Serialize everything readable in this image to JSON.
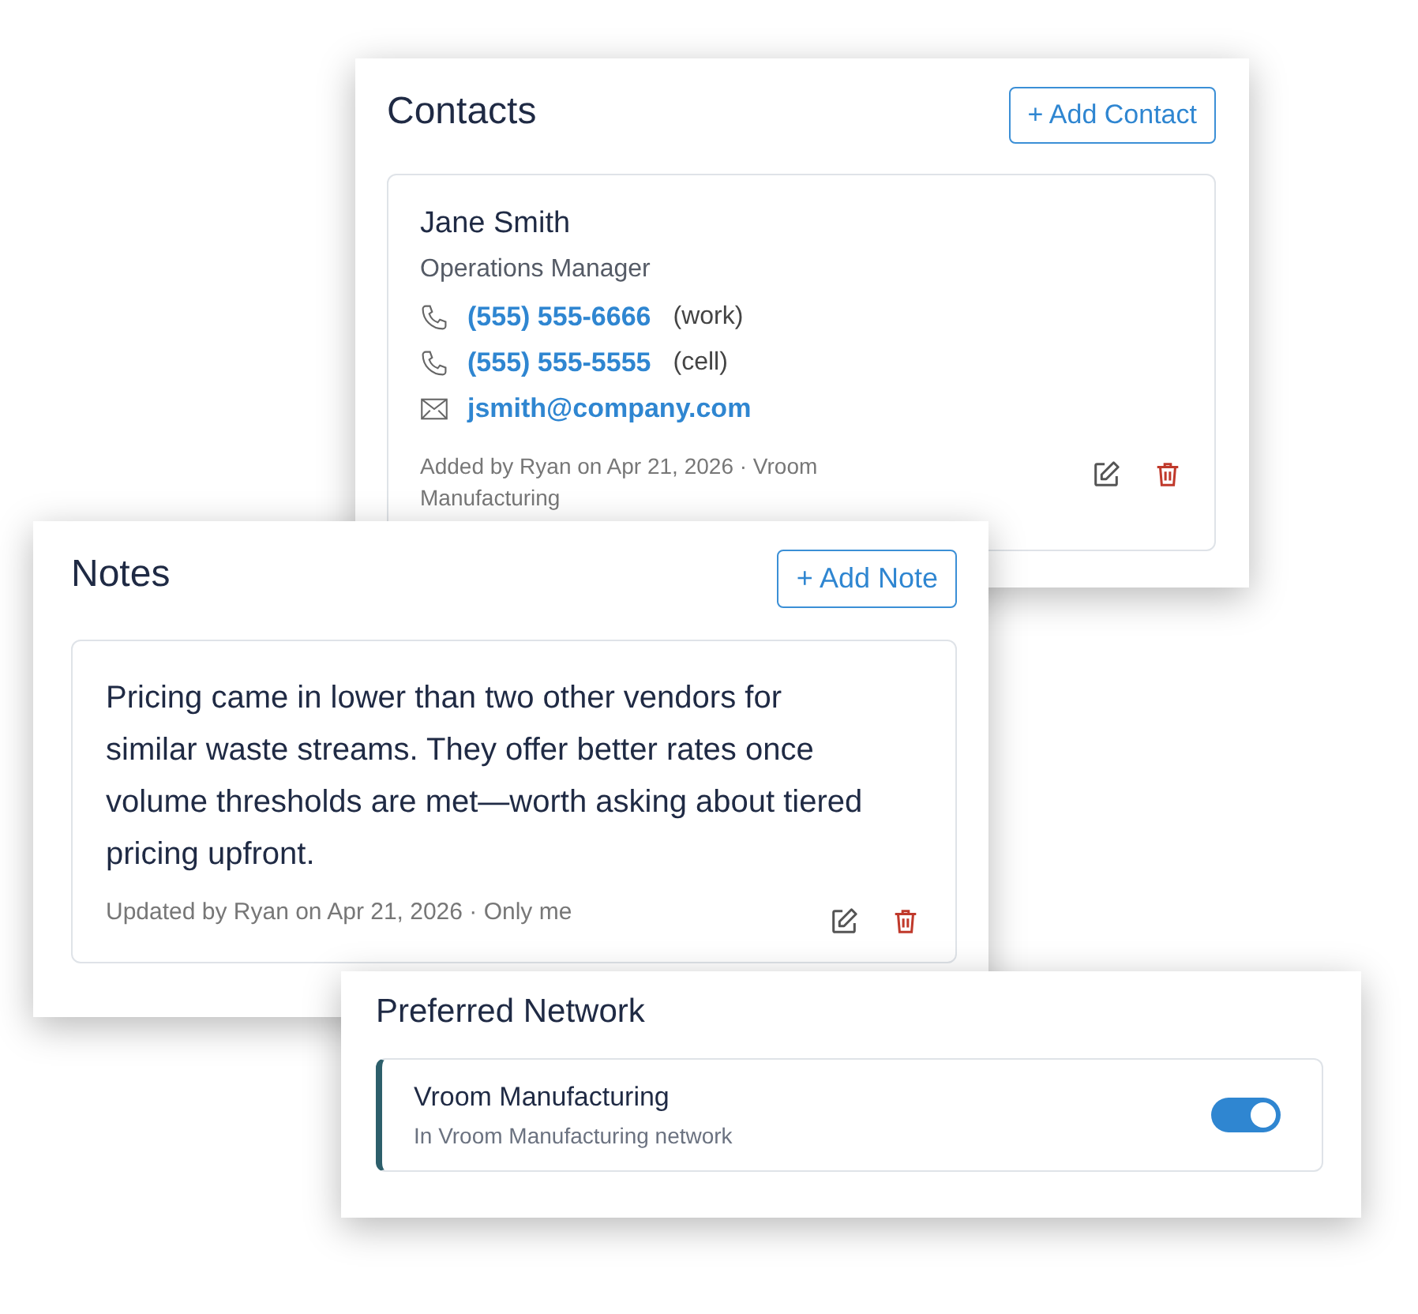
{
  "contacts": {
    "title": "Contacts",
    "add_button": "+ Add Contact",
    "items": [
      {
        "name": "Jane Smith",
        "role": "Operations Manager",
        "methods": [
          {
            "kind": "phone",
            "number": "(555) 555-6666",
            "tag": "(work)"
          },
          {
            "kind": "phone",
            "number": "(555) 555-5555",
            "tag": "(cell)"
          },
          {
            "kind": "email",
            "address": "jsmith@company.com"
          }
        ],
        "footer": "Added by Ryan on Apr 21, 2026 · Vroom Manufacturing"
      }
    ]
  },
  "notes": {
    "title": "Notes",
    "add_button": "+ Add Note",
    "items": [
      {
        "text": "Pricing came in lower than two other vendors for similar waste streams. They offer better rates once volume thresholds are met—worth asking about tiered pricing upfront.",
        "footer": "Updated by Ryan on Apr 21, 2026 · Only me"
      }
    ]
  },
  "preferred_network": {
    "title": "Preferred Network",
    "items": [
      {
        "name": "Vroom Manufacturing",
        "subtitle": "In Vroom Manufacturing network",
        "on": true
      }
    ]
  }
}
